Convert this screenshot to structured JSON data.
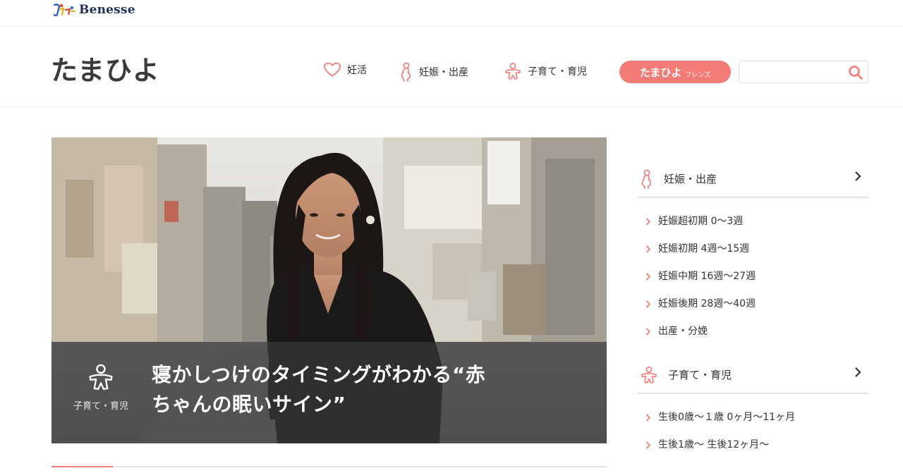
{
  "benesse": {
    "brand": "Benesse"
  },
  "header": {
    "logo": "たまひよ",
    "nav": [
      {
        "label": "妊活",
        "icon": "heart-icon"
      },
      {
        "label": "妊娠・出産",
        "icon": "pregnancy-icon"
      },
      {
        "label": "子育て・育児",
        "icon": "child-icon"
      }
    ],
    "friends": {
      "main": "たまひよ",
      "sub": "フレンズ"
    },
    "search": {
      "value": "",
      "placeholder": ""
    }
  },
  "hero": {
    "category": "子育て・育児",
    "title_line1": "寝かしつけのタイミングがわかる“赤",
    "title_line2": "ちゃんの眠いサイン”",
    "slider_progress": 0.11
  },
  "sidebar": {
    "sections": [
      {
        "title": "妊娠・出産",
        "items": [
          "妊娠超初期 0〜3週",
          "妊娠初期 4週〜15週",
          "妊娠中期 16週〜27週",
          "妊娠後期 28週〜40週",
          "出産・分娩"
        ]
      },
      {
        "title": "子育て・育児",
        "items": [
          "生後0歳〜１歳 0ヶ月〜11ヶ月",
          "生後1歳〜 生後12ヶ月〜"
        ]
      }
    ]
  },
  "colors": {
    "accent": "#f47b76",
    "text": "#333333",
    "caption_bg": "#373737"
  }
}
